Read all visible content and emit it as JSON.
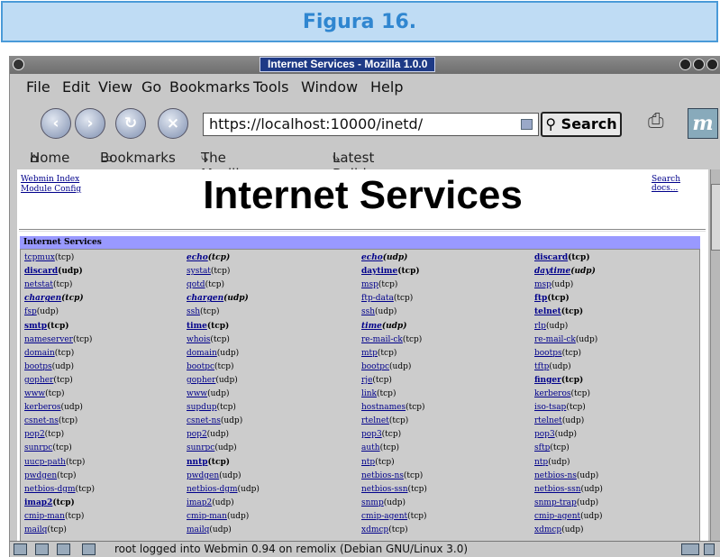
{
  "banner": {
    "title": "Figura 16."
  },
  "window": {
    "title": "Internet Services - Mozilla 1.0.0"
  },
  "menu": [
    "File",
    "Edit",
    "View",
    "Go",
    "Bookmarks",
    "Tools",
    "Window",
    "Help"
  ],
  "nav": {
    "url": "https://localhost:10000/inetd/",
    "search_label": "Search"
  },
  "bookmarks": [
    "Home",
    "Bookmarks",
    "The Mozilla Organi...",
    "Latest Builds"
  ],
  "page": {
    "links": [
      "Webmin Index",
      "Module Config"
    ],
    "title": "Internet Services",
    "search_docs": "Search docs...",
    "section": "Internet Services",
    "columns": [
      [
        {
          "n": "tcpmux",
          "p": "(tcp)",
          "s": ""
        },
        {
          "n": "discard",
          "p": "(udp)",
          "s": "b"
        },
        {
          "n": "netstat",
          "p": "(tcp)",
          "s": ""
        },
        {
          "n": "chargen",
          "p": "(tcp)",
          "s": "i"
        },
        {
          "n": "fsp",
          "p": "(udp)",
          "s": ""
        },
        {
          "n": "smtp",
          "p": "(tcp)",
          "s": "b"
        },
        {
          "n": "nameserver",
          "p": "(tcp)",
          "s": ""
        },
        {
          "n": "domain",
          "p": "(tcp)",
          "s": ""
        },
        {
          "n": "bootps",
          "p": "(udp)",
          "s": ""
        },
        {
          "n": "gopher",
          "p": "(tcp)",
          "s": ""
        },
        {
          "n": "www",
          "p": "(tcp)",
          "s": ""
        },
        {
          "n": "kerberos",
          "p": "(udp)",
          "s": ""
        },
        {
          "n": "csnet-ns",
          "p": "(tcp)",
          "s": ""
        },
        {
          "n": "pop2",
          "p": "(tcp)",
          "s": ""
        },
        {
          "n": "sunrpc",
          "p": "(tcp)",
          "s": ""
        },
        {
          "n": "uucp-path",
          "p": "(tcp)",
          "s": ""
        },
        {
          "n": "pwdgen",
          "p": "(tcp)",
          "s": ""
        },
        {
          "n": "netbios-dgm",
          "p": "(tcp)",
          "s": ""
        },
        {
          "n": "imap2",
          "p": "(tcp)",
          "s": "b"
        },
        {
          "n": "cmip-man",
          "p": "(tcp)",
          "s": ""
        },
        {
          "n": "mailq",
          "p": "(tcp)",
          "s": ""
        }
      ],
      [
        {
          "n": "echo",
          "p": "(tcp)",
          "s": "i"
        },
        {
          "n": "systat",
          "p": "(tcp)",
          "s": ""
        },
        {
          "n": "qotd",
          "p": "(tcp)",
          "s": ""
        },
        {
          "n": "chargen",
          "p": "(udp)",
          "s": "i"
        },
        {
          "n": "ssh",
          "p": "(tcp)",
          "s": ""
        },
        {
          "n": "time",
          "p": "(tcp)",
          "s": "b"
        },
        {
          "n": "whois",
          "p": "(tcp)",
          "s": ""
        },
        {
          "n": "domain",
          "p": "(udp)",
          "s": ""
        },
        {
          "n": "bootpc",
          "p": "(tcp)",
          "s": ""
        },
        {
          "n": "gopher",
          "p": "(udp)",
          "s": ""
        },
        {
          "n": "www",
          "p": "(udp)",
          "s": ""
        },
        {
          "n": "supdup",
          "p": "(tcp)",
          "s": ""
        },
        {
          "n": "csnet-ns",
          "p": "(udp)",
          "s": ""
        },
        {
          "n": "pop2",
          "p": "(udp)",
          "s": ""
        },
        {
          "n": "sunrpc",
          "p": "(udp)",
          "s": ""
        },
        {
          "n": "nntp",
          "p": "(tcp)",
          "s": "b"
        },
        {
          "n": "pwdgen",
          "p": "(udp)",
          "s": ""
        },
        {
          "n": "netbios-dgm",
          "p": "(udp)",
          "s": ""
        },
        {
          "n": "imap2",
          "p": "(udp)",
          "s": ""
        },
        {
          "n": "cmip-man",
          "p": "(udp)",
          "s": ""
        },
        {
          "n": "mailq",
          "p": "(udp)",
          "s": ""
        }
      ],
      [
        {
          "n": "echo",
          "p": "(udp)",
          "s": "i"
        },
        {
          "n": "daytime",
          "p": "(tcp)",
          "s": "b"
        },
        {
          "n": "msp",
          "p": "(tcp)",
          "s": ""
        },
        {
          "n": "ftp-data",
          "p": "(tcp)",
          "s": ""
        },
        {
          "n": "ssh",
          "p": "(udp)",
          "s": ""
        },
        {
          "n": "time",
          "p": "(udp)",
          "s": "i"
        },
        {
          "n": "re-mail-ck",
          "p": "(tcp)",
          "s": ""
        },
        {
          "n": "mtp",
          "p": "(tcp)",
          "s": ""
        },
        {
          "n": "bootpc",
          "p": "(udp)",
          "s": ""
        },
        {
          "n": "rje",
          "p": "(tcp)",
          "s": ""
        },
        {
          "n": "link",
          "p": "(tcp)",
          "s": ""
        },
        {
          "n": "hostnames",
          "p": "(tcp)",
          "s": ""
        },
        {
          "n": "rtelnet",
          "p": "(tcp)",
          "s": ""
        },
        {
          "n": "pop3",
          "p": "(tcp)",
          "s": ""
        },
        {
          "n": "auth",
          "p": "(tcp)",
          "s": ""
        },
        {
          "n": "ntp",
          "p": "(tcp)",
          "s": ""
        },
        {
          "n": "netbios-ns",
          "p": "(tcp)",
          "s": ""
        },
        {
          "n": "netbios-ssn",
          "p": "(tcp)",
          "s": ""
        },
        {
          "n": "snmp",
          "p": "(udp)",
          "s": ""
        },
        {
          "n": "cmip-agent",
          "p": "(tcp)",
          "s": ""
        },
        {
          "n": "xdmcp",
          "p": "(tcp)",
          "s": ""
        }
      ],
      [
        {
          "n": "discard",
          "p": "(tcp)",
          "s": "b"
        },
        {
          "n": "daytime",
          "p": "(udp)",
          "s": "i"
        },
        {
          "n": "msp",
          "p": "(udp)",
          "s": ""
        },
        {
          "n": "ftp",
          "p": "(tcp)",
          "s": "b"
        },
        {
          "n": "telnet",
          "p": "(tcp)",
          "s": "b"
        },
        {
          "n": "rlp",
          "p": "(udp)",
          "s": ""
        },
        {
          "n": "re-mail-ck",
          "p": "(udp)",
          "s": ""
        },
        {
          "n": "bootps",
          "p": "(tcp)",
          "s": ""
        },
        {
          "n": "tftp",
          "p": "(udp)",
          "s": ""
        },
        {
          "n": "finger",
          "p": "(tcp)",
          "s": "b"
        },
        {
          "n": "kerberos",
          "p": "(tcp)",
          "s": ""
        },
        {
          "n": "iso-tsap",
          "p": "(tcp)",
          "s": ""
        },
        {
          "n": "rtelnet",
          "p": "(udp)",
          "s": ""
        },
        {
          "n": "pop3",
          "p": "(udp)",
          "s": ""
        },
        {
          "n": "sftp",
          "p": "(tcp)",
          "s": ""
        },
        {
          "n": "ntp",
          "p": "(udp)",
          "s": ""
        },
        {
          "n": "netbios-ns",
          "p": "(udp)",
          "s": ""
        },
        {
          "n": "netbios-ssn",
          "p": "(udp)",
          "s": ""
        },
        {
          "n": "snmp-trap",
          "p": "(udp)",
          "s": ""
        },
        {
          "n": "cmip-agent",
          "p": "(udp)",
          "s": ""
        },
        {
          "n": "xdmcp",
          "p": "(udp)",
          "s": ""
        }
      ]
    ]
  },
  "status": {
    "message": "root logged into Webmin 0.94 on remolix (Debian GNU/Linux 3.0)"
  }
}
